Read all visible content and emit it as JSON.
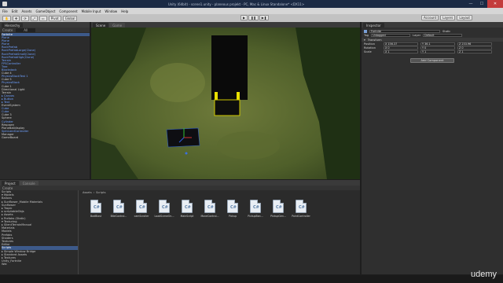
{
  "window": {
    "title": "Unity (64bit) - scene1.unity - planeous projekt - PC, Mac & Linux Standalone* <DX11>",
    "buttons": {
      "minimize": "—",
      "maximize": "☐",
      "close": "✕"
    }
  },
  "menu": [
    "File",
    "Edit",
    "Assets",
    "GameObject",
    "Component",
    "Mobile Input",
    "Window",
    "Help"
  ],
  "toolbar": {
    "tools": [
      "✋",
      "✥",
      "⟳",
      "⤢",
      "▭"
    ],
    "pivot": "Pivot",
    "global": "Global",
    "play": "▶",
    "pause": "❚❚",
    "step": "▶❚",
    "right_buttons": [
      "Account",
      "Layers",
      "Layout"
    ]
  },
  "hierarchy": {
    "tab": "Hierarchy",
    "create": "Create",
    "search_placeholder": "All",
    "root": "Fortnite",
    "items": [
      {
        "label": "Plane",
        "style": "blue"
      },
      {
        "label": "Plane",
        "style": "blue"
      },
      {
        "label": "Plane",
        "style": "blue"
      },
      {
        "label": "RockPrefab",
        "style": "blue"
      },
      {
        "label": "RockPrefabLarge(Clone)",
        "style": "blue"
      },
      {
        "label": "RockPrefabSmall(Clone)",
        "style": "blue"
      },
      {
        "label": "RockPrefabHigh(Clone)",
        "style": "blue"
      },
      {
        "label": "Terrain",
        "style": "blue"
      },
      {
        "label": "FPSController",
        "style": "blue"
      },
      {
        "label": "Tree",
        "style": "blue"
      },
      {
        "label": "Blockstack",
        "style": "blue"
      },
      {
        "label": "Cube 4",
        "style": "white"
      },
      {
        "label": "PhysicsBlockTest 1",
        "style": "blue"
      },
      {
        "label": "Cube 5",
        "style": "white"
      },
      {
        "label": "PhysicsBlock",
        "style": "blue"
      },
      {
        "label": "Cube 1",
        "style": "white"
      },
      {
        "label": "Directional Light",
        "style": "white"
      },
      {
        "label": "Terrain",
        "style": "white"
      },
      {
        "label": "▸ Canvas",
        "style": "blue"
      },
      {
        "label": "▸ Button",
        "style": "blue"
      },
      {
        "label": "▸ Text",
        "style": "blue"
      },
      {
        "label": "EventSystem",
        "style": "white"
      },
      {
        "label": "Cube",
        "style": "blue"
      },
      {
        "label": "Cube",
        "style": "blue"
      },
      {
        "label": "Cube 3",
        "style": "white"
      },
      {
        "label": "Sphere",
        "style": "white"
      },
      {
        "label": "Cylinder",
        "style": "blue"
      },
      {
        "label": "Respawn",
        "style": "white"
      },
      {
        "label": "PlaneBalldisplay",
        "style": "white"
      },
      {
        "label": "SpinLandController",
        "style": "blue"
      },
      {
        "label": "Manager",
        "style": "white"
      },
      {
        "label": "GameBoard",
        "style": "white"
      }
    ]
  },
  "scene": {
    "tabs": [
      "Scene",
      "Game"
    ],
    "toolbar_items": [
      "Shaded",
      "2D",
      "☀",
      "♪",
      "Effects",
      "Gizmos",
      "All"
    ]
  },
  "inspector": {
    "tab": "Inspector",
    "object_name": "Fortnite",
    "static_label": "Static",
    "tag_label": "Tag",
    "tag_value": "Untagged",
    "layer_label": "Layer",
    "layer_value": "Default",
    "transform_header": "Transform",
    "rows": [
      {
        "label": "Position",
        "x": "X 156.37",
        "y": "Y 36.1",
        "z": "Z 233.96"
      },
      {
        "label": "Rotation",
        "x": "X 0",
        "y": "Y 0",
        "z": "Z 0"
      },
      {
        "label": "Scale",
        "x": "X 1",
        "y": "Y 1",
        "z": "Z 1"
      }
    ],
    "add_component": "Add Component"
  },
  "project": {
    "tabs": [
      "Project",
      "Console"
    ],
    "create": "Create",
    "tree": [
      {
        "label": "Scripts",
        "sel": false
      },
      {
        "label": "  ▾ Models",
        "sel": false
      },
      {
        "label": "    Ballons",
        "sel": false
      },
      {
        "label": "  ▸ Sunflower_Mobile Materials",
        "sel": false
      },
      {
        "label": "    Sunflower",
        "sel": false
      },
      {
        "label": "  ▸ Tropic",
        "sel": false
      },
      {
        "label": "  ▸ scriptableObjs",
        "sel": false
      },
      {
        "label": "  ▸ Assets",
        "sel": false
      },
      {
        "label": "  ▸ Prefabs (Static)",
        "sel": false
      },
      {
        "label": "  ▾ Texturing",
        "sel": false
      },
      {
        "label": "    ▸ SilentTerrainManual",
        "sel": false
      },
      {
        "label": "      Materials",
        "sel": false
      },
      {
        "label": "      Models",
        "sel": false
      },
      {
        "label": "      Prefabs",
        "sel": false
      },
      {
        "label": "      Shaders",
        "sel": false
      },
      {
        "label": "      Textures",
        "sel": false
      },
      {
        "label": "      Editor",
        "sel": false
      },
      {
        "label": "  Scripts",
        "sel": true
      },
      {
        "label": "▸ Simple Window Bridge",
        "sel": false
      },
      {
        "label": "▸ Standard Assets",
        "sel": false
      },
      {
        "label": "▸ Textures",
        "sel": false
      },
      {
        "label": "  Unity_Fortnite",
        "sel": false
      },
      {
        "label": "  Wal",
        "sel": false
      }
    ],
    "breadcrumb": [
      "Assets",
      "Scripts"
    ],
    "files": [
      "BadBlast",
      "BiteControl...",
      "camScroller",
      "LoadSceneOn...",
      "MainScript",
      "MoveControl...",
      "Pickup",
      "PickupBan...",
      "PickupGen...",
      "PointController"
    ]
  },
  "watermark": "udemy"
}
